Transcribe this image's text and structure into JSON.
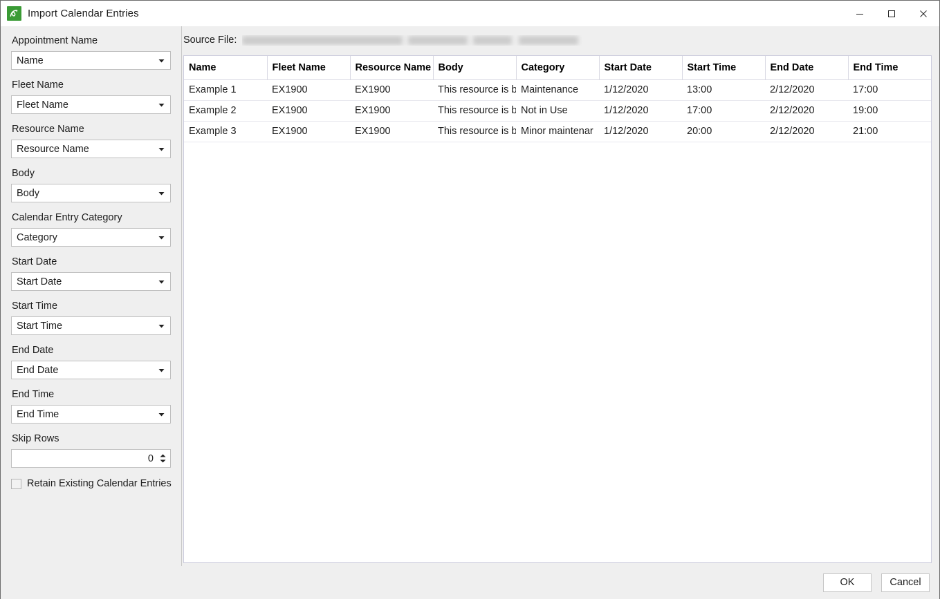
{
  "window": {
    "title": "Import Calendar Entries",
    "app_icon": "calendar-import-app-icon",
    "controls": {
      "minimize": "minimize-icon",
      "maximize": "maximize-icon",
      "close": "close-icon"
    },
    "accent_green": "#3a9b35",
    "chrome_bg": "#efefef"
  },
  "sidebar": {
    "fields": [
      {
        "label": "Appointment Name",
        "value": "Name"
      },
      {
        "label": "Fleet Name",
        "value": "Fleet Name"
      },
      {
        "label": "Resource Name",
        "value": "Resource Name"
      },
      {
        "label": "Body",
        "value": "Body"
      },
      {
        "label": "Calendar Entry Category",
        "value": "Category"
      },
      {
        "label": "Start Date",
        "value": "Start Date"
      },
      {
        "label": "Start Time",
        "value": "Start Time"
      },
      {
        "label": "End Date",
        "value": "End Date"
      },
      {
        "label": "End Time",
        "value": "End Time"
      }
    ],
    "skip_rows": {
      "label": "Skip Rows",
      "value": "0"
    },
    "retain_checkbox": {
      "label": "Retain Existing Calendar Entries",
      "checked": false
    }
  },
  "main": {
    "source_file_label": "Source File:",
    "source_file_value": "",
    "table": {
      "columns": [
        "Name",
        "Fleet Name",
        "Resource Name",
        "Body",
        "Category",
        "Start Date",
        "Start Time",
        "End Date",
        "End Time"
      ],
      "rows": [
        {
          "name": "Example 1",
          "fleet_name": "EX1900",
          "resource_name": "EX1900",
          "body": "This resource is b",
          "category": "Maintenance",
          "start_date": "1/12/2020",
          "start_time": "13:00",
          "end_date": "2/12/2020",
          "end_time": "17:00"
        },
        {
          "name": "Example 2",
          "fleet_name": "EX1900",
          "resource_name": "EX1900",
          "body": "This resource is b",
          "category": "Not in Use",
          "start_date": "1/12/2020",
          "start_time": "17:00",
          "end_date": "2/12/2020",
          "end_time": "19:00"
        },
        {
          "name": "Example 3",
          "fleet_name": "EX1900",
          "resource_name": "EX1900",
          "body": "This resource is b",
          "category": "Minor maintenar",
          "start_date": "1/12/2020",
          "start_time": "20:00",
          "end_date": "2/12/2020",
          "end_time": "21:00"
        }
      ]
    }
  },
  "footer": {
    "ok_label": "OK",
    "cancel_label": "Cancel"
  }
}
